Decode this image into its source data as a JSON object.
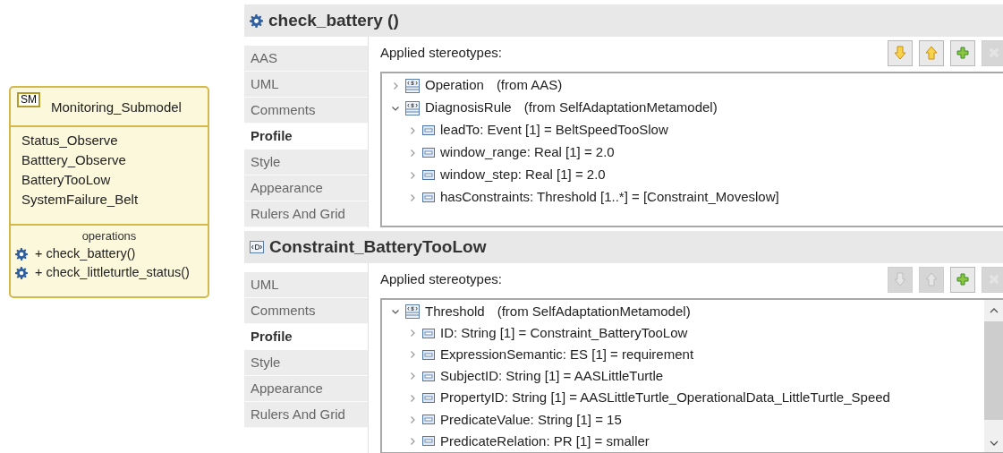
{
  "class_box": {
    "badge": "SM",
    "name": "Monitoring_Submodel",
    "attributes": [
      "Status_Observe",
      "Batttery_Observe",
      "BatteryTooLow",
      "SystemFailure_Belt"
    ],
    "operations_label": "operations",
    "operations": [
      "+ check_battery()",
      "+ check_littleturtle_status()"
    ]
  },
  "panels": [
    {
      "kind": "operation",
      "title": "check_battery ()",
      "section_label": "Applied stereotypes:",
      "tabs": [
        {
          "label": "AAS",
          "selected": false
        },
        {
          "label": "UML",
          "selected": false
        },
        {
          "label": "Comments",
          "selected": false
        },
        {
          "label": "Profile",
          "selected": true
        },
        {
          "label": "Style",
          "selected": false
        },
        {
          "label": "Appearance",
          "selected": false
        },
        {
          "label": "Rulers And Grid",
          "selected": false
        }
      ],
      "toolbar": [
        {
          "kind": "down",
          "disabled": false
        },
        {
          "kind": "up",
          "disabled": false
        },
        {
          "kind": "add",
          "disabled": false
        },
        {
          "kind": "remove",
          "disabled": true
        }
      ],
      "scrollbar": false,
      "tree": [
        {
          "kind": "stereotype",
          "name": "Operation",
          "source": "(from AAS)",
          "expanded": false
        },
        {
          "kind": "stereotype",
          "name": "DiagnosisRule",
          "source": "(from SelfAdaptationMetamodel)",
          "expanded": true,
          "children": [
            {
              "kind": "property",
              "name": "leadTo: Event [1] = BeltSpeedTooSlow",
              "expanded": false
            },
            {
              "kind": "property",
              "name": "window_range: Real [1] = 2.0",
              "expanded": false
            },
            {
              "kind": "property",
              "name": "window_step: Real [1] = 2.0",
              "expanded": false
            },
            {
              "kind": "property",
              "name": "hasConstraints: Threshold [1..*] = [Constraint_Moveslow]",
              "expanded": false
            }
          ]
        }
      ]
    },
    {
      "kind": "constraint",
      "title": "Constraint_BatteryTooLow",
      "section_label": "Applied stereotypes:",
      "tabs": [
        {
          "label": "UML",
          "selected": false
        },
        {
          "label": "Comments",
          "selected": false
        },
        {
          "label": "Profile",
          "selected": true
        },
        {
          "label": "Style",
          "selected": false
        },
        {
          "label": "Appearance",
          "selected": false
        },
        {
          "label": "Rulers And Grid",
          "selected": false
        }
      ],
      "toolbar": [
        {
          "kind": "down",
          "disabled": true
        },
        {
          "kind": "up",
          "disabled": true
        },
        {
          "kind": "add",
          "disabled": false
        },
        {
          "kind": "remove",
          "disabled": true
        }
      ],
      "scrollbar": true,
      "tree": [
        {
          "kind": "stereotype",
          "name": "Threshold",
          "source": "(from SelfAdaptationMetamodel)",
          "expanded": true,
          "children": [
            {
              "kind": "property",
              "name": "ID: String [1] = Constraint_BatteryTooLow",
              "expanded": false
            },
            {
              "kind": "property",
              "name": "ExpressionSemantic: ES [1] = requirement",
              "expanded": false
            },
            {
              "kind": "property",
              "name": "SubjectID: String [1] = AASLittleTurtle",
              "expanded": false
            },
            {
              "kind": "property",
              "name": "PropertyID: String [1] = AASLittleTurtle_OperationalData_LittleTurtle_Speed",
              "expanded": false
            },
            {
              "kind": "property",
              "name": "PredicateValue: String [1] = 15",
              "expanded": false
            },
            {
              "kind": "property",
              "name": "PredicateRelation: PR [1] = smaller",
              "expanded": false
            }
          ]
        }
      ]
    }
  ]
}
